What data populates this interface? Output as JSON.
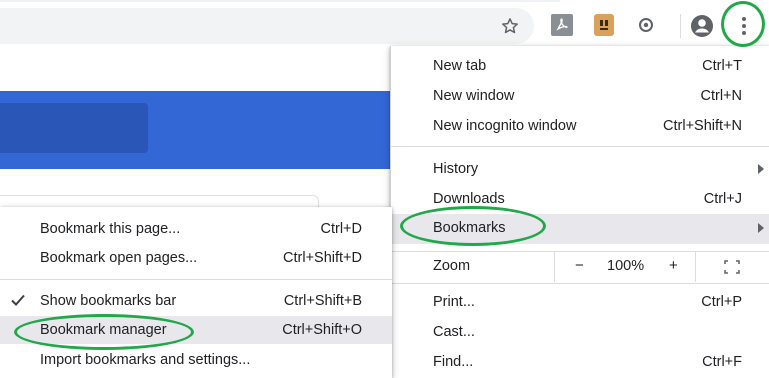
{
  "menu": {
    "items": [
      {
        "label": "New tab",
        "shortcut": "Ctrl+T"
      },
      {
        "label": "New window",
        "shortcut": "Ctrl+N"
      },
      {
        "label": "New incognito window",
        "shortcut": "Ctrl+Shift+N"
      },
      {
        "label": "History",
        "shortcut": ""
      },
      {
        "label": "Downloads",
        "shortcut": "Ctrl+J"
      },
      {
        "label": "Bookmarks",
        "shortcut": ""
      },
      {
        "label": "Zoom",
        "shortcut": ""
      },
      {
        "label": "Print...",
        "shortcut": "Ctrl+P"
      },
      {
        "label": "Cast...",
        "shortcut": ""
      },
      {
        "label": "Find...",
        "shortcut": "Ctrl+F"
      }
    ],
    "zoom": {
      "minus": "−",
      "value": "100%",
      "plus": "+"
    }
  },
  "bookmarks_submenu": {
    "items": [
      {
        "label": "Bookmark this page...",
        "shortcut": "Ctrl+D"
      },
      {
        "label": "Bookmark open pages...",
        "shortcut": "Ctrl+Shift+D"
      },
      {
        "label": "Show bookmarks bar",
        "shortcut": "Ctrl+Shift+B",
        "checked": true
      },
      {
        "label": "Bookmark manager",
        "shortcut": "Ctrl+Shift+O"
      },
      {
        "label": "Import bookmarks and settings...",
        "shortcut": ""
      }
    ]
  },
  "toolbar": {
    "icons": [
      "star-icon",
      "pdf-extension-icon",
      "extension-icon",
      "globe-extension-icon",
      "account-icon",
      "kebab-menu-icon"
    ]
  },
  "colors": {
    "accent": "#3367d6",
    "annotation": "#22a84a",
    "highlight": "#e8e8ec"
  }
}
